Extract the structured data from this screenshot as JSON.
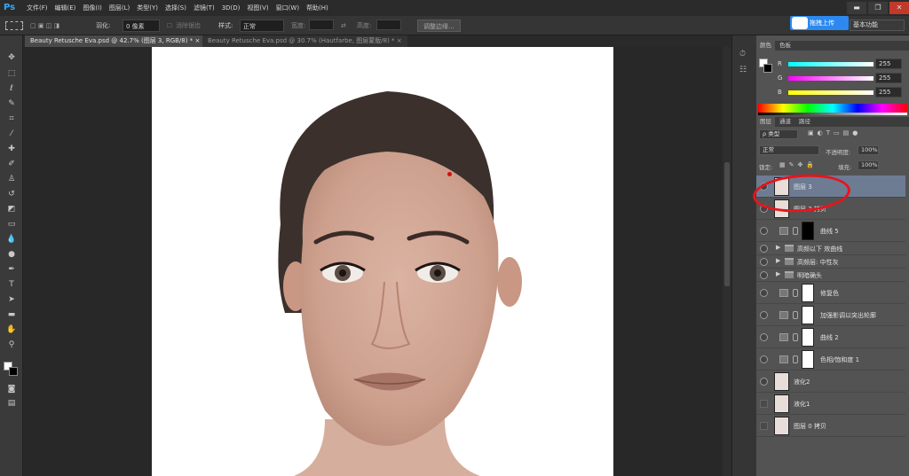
{
  "app": {
    "logo": "Ps"
  },
  "menu": [
    "文件(F)",
    "编辑(E)",
    "图像(I)",
    "图层(L)",
    "类型(Y)",
    "选择(S)",
    "滤镜(T)",
    "3D(D)",
    "视图(V)",
    "窗口(W)",
    "帮助(H)"
  ],
  "window_controls": {
    "minimize": "▬",
    "restore": "❐",
    "close": "✕"
  },
  "options": {
    "feather_label": "羽化:",
    "feather_value": "0 像素",
    "antialias_label": "消除锯齿",
    "style_label": "样式:",
    "style_value": "正常",
    "width_label": "宽度:",
    "height_label": "高度:",
    "refine_edge": "调整边缘..."
  },
  "upload_button": "拖拽上传",
  "workspace": "基本功能",
  "tabs": [
    {
      "label": "Beauty Retusche Eva.psd @ 42.7% (图层 3, RGB/8) *",
      "close": "×"
    },
    {
      "label": "Beauty Retusche Eva.psd @ 30.7% (Hautfarbe, 图层蒙版/8) *",
      "close": "×"
    }
  ],
  "color_panel": {
    "tabs": [
      "颜色",
      "色板"
    ],
    "channels": [
      {
        "label": "R",
        "value": "255",
        "gradient": "#00ffff"
      },
      {
        "label": "G",
        "value": "255",
        "gradient": "#ff00ff"
      },
      {
        "label": "B",
        "value": "255",
        "gradient": "#ffff00"
      }
    ]
  },
  "layers_panel": {
    "tabs": [
      "图层",
      "通道",
      "路径"
    ],
    "filter_label": "ρ 类型",
    "blend_mode": "正常",
    "opacity_label": "不透明度:",
    "opacity_value": "100%",
    "lock_label": "锁定:",
    "fill_label": "填充:",
    "fill_value": "100%",
    "layers": [
      {
        "name": "图层 3",
        "kind": "pixel",
        "visible": true,
        "selected": true
      },
      {
        "name": "图层 3 拷贝",
        "kind": "pixel",
        "visible": true,
        "selected": false
      },
      {
        "name": "曲线 5",
        "kind": "adjustment",
        "visible": true,
        "selected": false
      },
      {
        "name": "高频以下 效曲线",
        "kind": "group",
        "visible": true,
        "selected": false
      },
      {
        "name": "高频层: 中性灰",
        "kind": "group",
        "visible": true,
        "selected": false
      },
      {
        "name": "明暗确头",
        "kind": "group",
        "visible": true,
        "selected": false
      },
      {
        "name": "修复色",
        "kind": "adjustment",
        "visible": true,
        "selected": false
      },
      {
        "name": "加强影调以突出轮廓",
        "kind": "adjustment",
        "visible": true,
        "selected": false
      },
      {
        "name": "曲线 2",
        "kind": "adjustment",
        "visible": true,
        "selected": false
      },
      {
        "name": "色相/饱和度 1",
        "kind": "adjustment",
        "visible": true,
        "selected": false
      },
      {
        "name": "液化2",
        "kind": "pixel",
        "visible": true,
        "selected": false
      },
      {
        "name": "液化1",
        "kind": "pixel",
        "visible": false,
        "selected": false
      },
      {
        "name": "图层 0 拷贝",
        "kind": "pixel",
        "visible": false,
        "selected": false
      }
    ]
  }
}
